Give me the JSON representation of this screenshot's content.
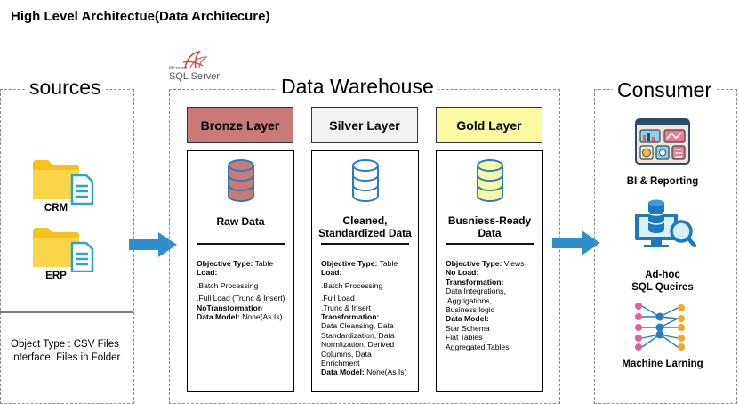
{
  "page_title": "High Level Architectue(Data Architecure)",
  "sources": {
    "title": "sources",
    "items": [
      {
        "label": "CRM",
        "icon": "folder-document-icon"
      },
      {
        "label": "ERP",
        "icon": "folder-document-icon"
      }
    ],
    "info": [
      "Object Type : CSV Files",
      "Interface: Files in Folder"
    ]
  },
  "warehouse": {
    "title": "Data Warehouse",
    "platform_logo": {
      "text": "SQL Server",
      "small_text": "Microsoft",
      "icon": "sql-server-logo-icon"
    },
    "layers": {
      "bronze": {
        "header": "Bronze Layer",
        "header_color": "#c97a77",
        "db_color": "#c97a77",
        "title": "Raw Data",
        "objective_label": "Objective Type:",
        "objective_value": "Table",
        "load_label": "Load:",
        "load_items": [
          ".Batch Processing",
          ".Full Load (Trunc & Insert)"
        ],
        "transformation_label": "NoTransformation",
        "model_label": "Data Model:",
        "model_value": "None(As Is)"
      },
      "silver": {
        "header": "Silver Layer",
        "header_color": "#f2f2f2",
        "db_color": "#dce9f7",
        "title_line1": "Cleaned,",
        "title_line2": "Standardized Data",
        "objective_label": "Objective Type:",
        "objective_value": "Table",
        "load_label": "Load:",
        "load_items": [
          ".Batch Processing",
          ".Full Load",
          ".Trunc & Insert"
        ],
        "transformation_label": "Transformation:",
        "transformation_items": [
          "Data Cleansing, Data",
          "Standardization, Data",
          "Normlization, Derived",
          "Columns, Data",
          "Enrichment"
        ],
        "model_label": "Data Model:",
        "model_value": "None(As Is)"
      },
      "gold": {
        "header": "Gold Layer",
        "header_color": "#fafaa0",
        "db_color": "#f7f7a6",
        "title_line1": "Busniess-Ready",
        "title_line2": "Data",
        "objective_label": "Objective Type:",
        "objective_value": "Views",
        "load_label": "No Load:",
        "transformation_label": "Transformation:",
        "transformation_items": [
          "Data Integrations,",
          " Aggrigations,",
          "Business logic"
        ],
        "model_label": "Data Model:",
        "model_items": [
          "Star Schema",
          "Flat Tables",
          "Aggregated Tables"
        ]
      }
    }
  },
  "consumer": {
    "title": "Consumer",
    "items": [
      {
        "label": "BI & Reporting",
        "icon": "dashboard-icon"
      },
      {
        "label_line1": "Ad-hoc",
        "label_line2": "SQL Queires",
        "icon": "database-search-icon"
      },
      {
        "label": "Machine Larning",
        "icon": "neural-network-icon"
      }
    ]
  },
  "colors": {
    "arrow": "#2e8fcf",
    "db_stroke": "#2b7bbd",
    "folder": "#f6c21b",
    "document": "#27a4d8",
    "dashed_border": "#8a8a8a"
  }
}
